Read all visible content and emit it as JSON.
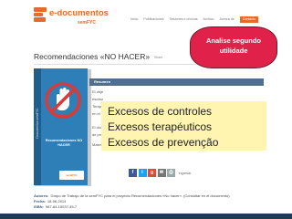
{
  "header": {
    "logo_title": "e-documentos",
    "logo_subtitle": "semFYC",
    "nav": [
      "Inicio",
      "Publicaciones",
      "Sesiones e-clínicas",
      "Archivo",
      "Acerca de",
      "Contacto"
    ]
  },
  "main": {
    "title": "Recomendaciones «NO HACER»",
    "share_label": "Share",
    "summary": {
      "label": "Resumen",
      "lines": [
        "El obje",
        "escasa",
        "Terapé",
        "en el S",
        "El docu",
        "de pres"
      ],
      "material_label": "Mater"
    },
    "share_buttons": [
      {
        "icon": "facebook-icon",
        "glyph": "f"
      },
      {
        "icon": "twitter-icon",
        "glyph": "t"
      },
      {
        "icon": "google-plus-icon",
        "glyph": "g"
      },
      {
        "icon": "mail-icon",
        "glyph": "✉"
      },
      {
        "icon": "print-icon",
        "glyph": "⎙"
      }
    ],
    "share_text": "Ingresar",
    "book": {
      "title": "Recomendaciones NO HACER",
      "spine": "Documentos semFYC",
      "brand": "semFYC"
    },
    "meta": [
      {
        "label": "Autores:",
        "value": "Grupo de Trabajo de la semFYC para el proyecto Recomendaciones «No hacer». (Consultar en el documento)"
      },
      {
        "label": "Fecha:",
        "value": "18-06-2014"
      },
      {
        "label": "ISBN:",
        "value": "987-84-15037-45-7"
      }
    ]
  },
  "overlay": {
    "analise_line1": "Analise segundo",
    "analise_line2": "utilidade",
    "callout": [
      "Excesos de controles",
      "Excesos terapéuticos",
      "Excesos de prevenção"
    ]
  },
  "colors": {
    "brand_orange": "#e66a2c",
    "book_blue": "#2e7eb8",
    "callout_yellow": "#fff5b0",
    "analise_red": "#e0224a",
    "resumen_bar": "#4f6f8c"
  }
}
